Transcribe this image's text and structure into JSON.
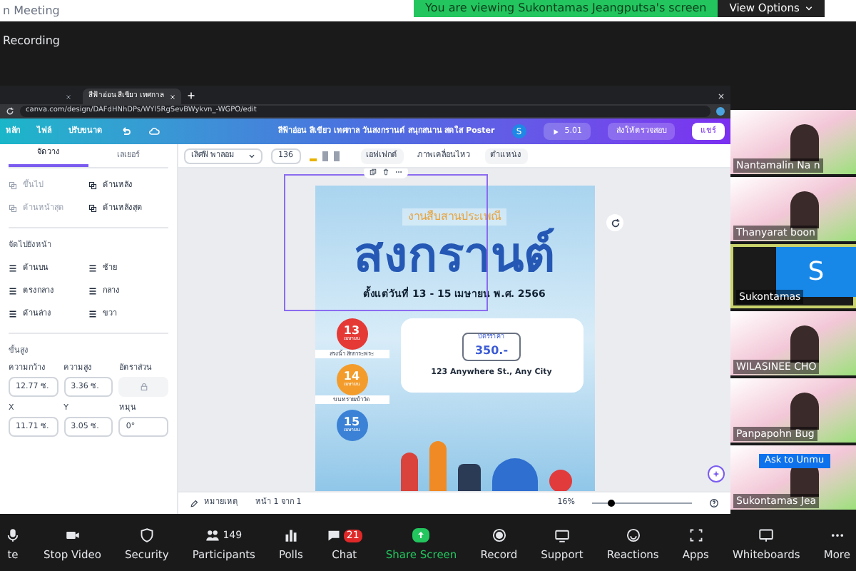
{
  "window": {
    "title": "n Meeting"
  },
  "share_banner": {
    "text": "You are viewing Sukontamas Jeangputsa's screen",
    "button": "View Options"
  },
  "recording": "Recording",
  "browser": {
    "tabs": [
      {
        "selected": false
      },
      {
        "label": "สีฟ้าอ่อน สีเขียว เทศกาล",
        "selected": true
      }
    ],
    "url": "canva.com/design/DAFdHNhDPs/WYl5RgSevBWykvn_-WGPO/edit"
  },
  "canva": {
    "menu": [
      "หลัก",
      "ไฟล์",
      "ปรับขนาด"
    ],
    "title": "สีฟ้าอ่อน สีเขียว เทศกาล วันสงกรานต์ สนุกสนาน สดใส Poster",
    "avatar": "S",
    "present": "5.01",
    "review": "ส่งให้ตรวจสอบ",
    "share": "แชร์",
    "toolbar": {
      "font": "เลิศฟิ พาลอม",
      "size": "136",
      "effects": "เอฟเฟกต์",
      "animate": "ภาพเคลื่อนไหว",
      "position": "ตำแหน่ง"
    },
    "panel": {
      "tabs": [
        {
          "label": "จัดวาง",
          "selected": true
        },
        {
          "label": "เลเยอร์",
          "selected": false
        }
      ],
      "order": [
        {
          "label": "ขึ้นไป",
          "disabled": true
        },
        {
          "label": "ด้านหลัง",
          "disabled": false
        },
        {
          "label": "ด้านหน้าสุด",
          "disabled": true
        },
        {
          "label": "ด้านหลังสุด",
          "disabled": false
        }
      ],
      "align_title": "จัดไปยังหน้า",
      "align": [
        "ด้านบน",
        "ซ้าย",
        "ตรงกลาง",
        "กลาง",
        "ด้านล่าง",
        "ขวา"
      ],
      "advanced_title": "ขั้นสูง",
      "fields": [
        {
          "label": "ความกว้าง",
          "value": "12.77 ซ.",
          "kind": "text"
        },
        {
          "label": "ความสูง",
          "value": "3.36 ซ.",
          "kind": "text"
        },
        {
          "label": "อัตราส่วน",
          "kind": "lock"
        },
        {
          "label": "X",
          "value": "11.71 ซ.",
          "kind": "text"
        },
        {
          "label": "Y",
          "value": "3.05 ซ.",
          "kind": "text"
        },
        {
          "label": "หมุน",
          "value": "0°",
          "kind": "text"
        }
      ]
    },
    "poster": {
      "subtitle": "งานสืบสานประเพณี",
      "headline": "สงกรานต์",
      "dates": "ตั้งแต่วันที่ 13 - 15 เมษายน พ.ศ. 2566",
      "days": [
        {
          "day": "13",
          "month": "เมษายน",
          "note": "สรงน้ำ สักการะพระ",
          "color": "#e53935"
        },
        {
          "day": "14",
          "month": "เมษายน",
          "note": "ขนทรายเข้าวัด",
          "color": "#f39c2b"
        },
        {
          "day": "15",
          "month": "เมษายน",
          "color": "#3b82d6"
        }
      ],
      "ticket_label": "บัตรราคา",
      "price": "350.-",
      "address": "123 Anywhere St., Any City"
    },
    "footer": {
      "notes": "หมายเหตุ",
      "page": "หน้า 1 จาก 1",
      "zoom": "16%",
      "level": 0.15
    }
  },
  "participants": [
    {
      "name": "Nantamalin Na n",
      "kind": "video",
      "active": false
    },
    {
      "name": "Thanyarat boon",
      "kind": "video",
      "active": false
    },
    {
      "name": "Sukontamas",
      "kind": "initial",
      "initial": "S",
      "active": true
    },
    {
      "name": "WILASINEE CHO",
      "kind": "video",
      "active": false
    },
    {
      "name": "Panpapohn Bug",
      "kind": "video",
      "active": false
    },
    {
      "name": "Sukontamas Jea",
      "kind": "video",
      "active": false,
      "badge": "Ask to Unmu"
    }
  ],
  "controls": [
    {
      "label": "te",
      "kind": "mic"
    },
    {
      "label": "Stop Video",
      "kind": "video"
    },
    {
      "label": "Security",
      "kind": "shield"
    },
    {
      "label": "Participants",
      "kind": "people",
      "count": "149"
    },
    {
      "label": "Polls",
      "kind": "bars"
    },
    {
      "label": "Chat",
      "kind": "chat",
      "count": "21"
    },
    {
      "label": "Share Screen",
      "kind": "share"
    },
    {
      "label": "Record",
      "kind": "record"
    },
    {
      "label": "Support",
      "kind": "support"
    },
    {
      "label": "Reactions",
      "kind": "smile"
    },
    {
      "label": "Apps",
      "kind": "apps"
    },
    {
      "label": "Whiteboards",
      "kind": "board"
    },
    {
      "label": "More",
      "kind": "more"
    }
  ]
}
